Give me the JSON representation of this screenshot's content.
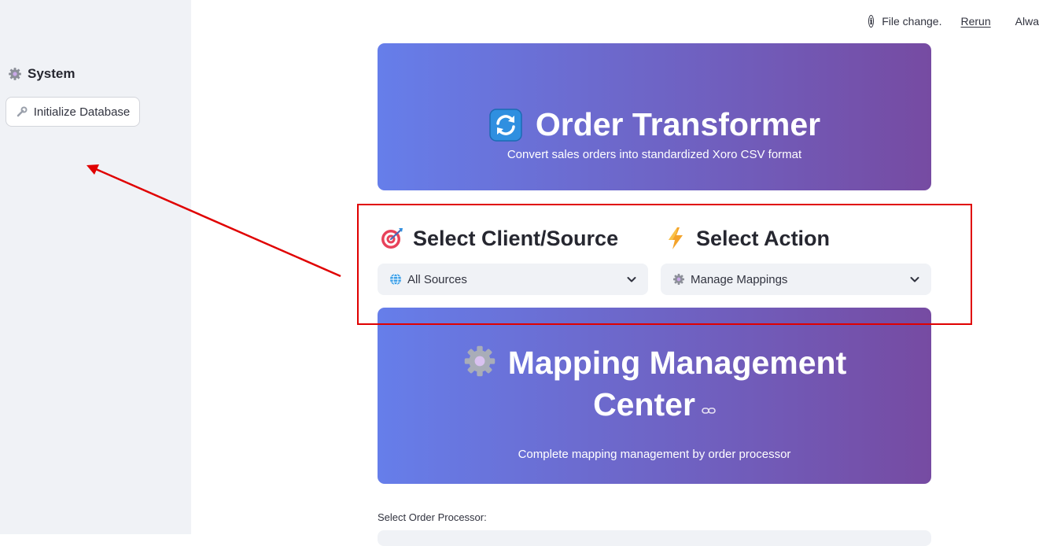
{
  "sidebar": {
    "heading": "System",
    "button_label": "Initialize Database"
  },
  "toolbar": {
    "status": "File change.",
    "rerun": "Rerun",
    "always": "Alwa"
  },
  "hero": {
    "title": "Order Transformer",
    "subtitle": "Convert sales orders into standardized Xoro CSV format"
  },
  "client_select": {
    "heading": "Select Client/Source",
    "value": "All Sources"
  },
  "action_select": {
    "heading": "Select Action",
    "value": "Manage Mappings"
  },
  "mapping_hero": {
    "title_line1": "Mapping Management",
    "title_line2": "Center",
    "subtitle": "Complete mapping management by order processor"
  },
  "order_processor": {
    "label": "Select Order Processor:"
  },
  "colors": {
    "gradient_start": "#667eea",
    "gradient_end": "#764ba2",
    "annotation": "#e00000",
    "sidebar_bg": "#f0f2f6"
  },
  "icons": [
    "gear-icon",
    "wrench-icon",
    "info-icon",
    "refresh-icon",
    "target-icon",
    "lightning-icon",
    "globe-icon",
    "chevron-down-icon",
    "link-icon"
  ]
}
